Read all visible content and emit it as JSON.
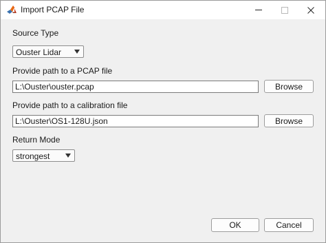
{
  "window": {
    "title": "Import PCAP File",
    "app_icon": "matlab-icon",
    "controls": [
      "minimize-icon",
      "maximize-icon",
      "close-icon"
    ]
  },
  "source_type": {
    "label": "Source Type",
    "selected": "Ouster Lidar"
  },
  "pcap": {
    "label": "Provide path to a PCAP file",
    "value": "L:\\Ouster\\ouster.pcap",
    "browse_label": "Browse"
  },
  "calibration": {
    "label": "Provide path to a calibration file",
    "value": "L:\\Ouster\\OS1-128U.json",
    "browse_label": "Browse"
  },
  "return_mode": {
    "label": "Return Mode",
    "selected": "strongest"
  },
  "footer": {
    "ok_label": "OK",
    "cancel_label": "Cancel"
  }
}
